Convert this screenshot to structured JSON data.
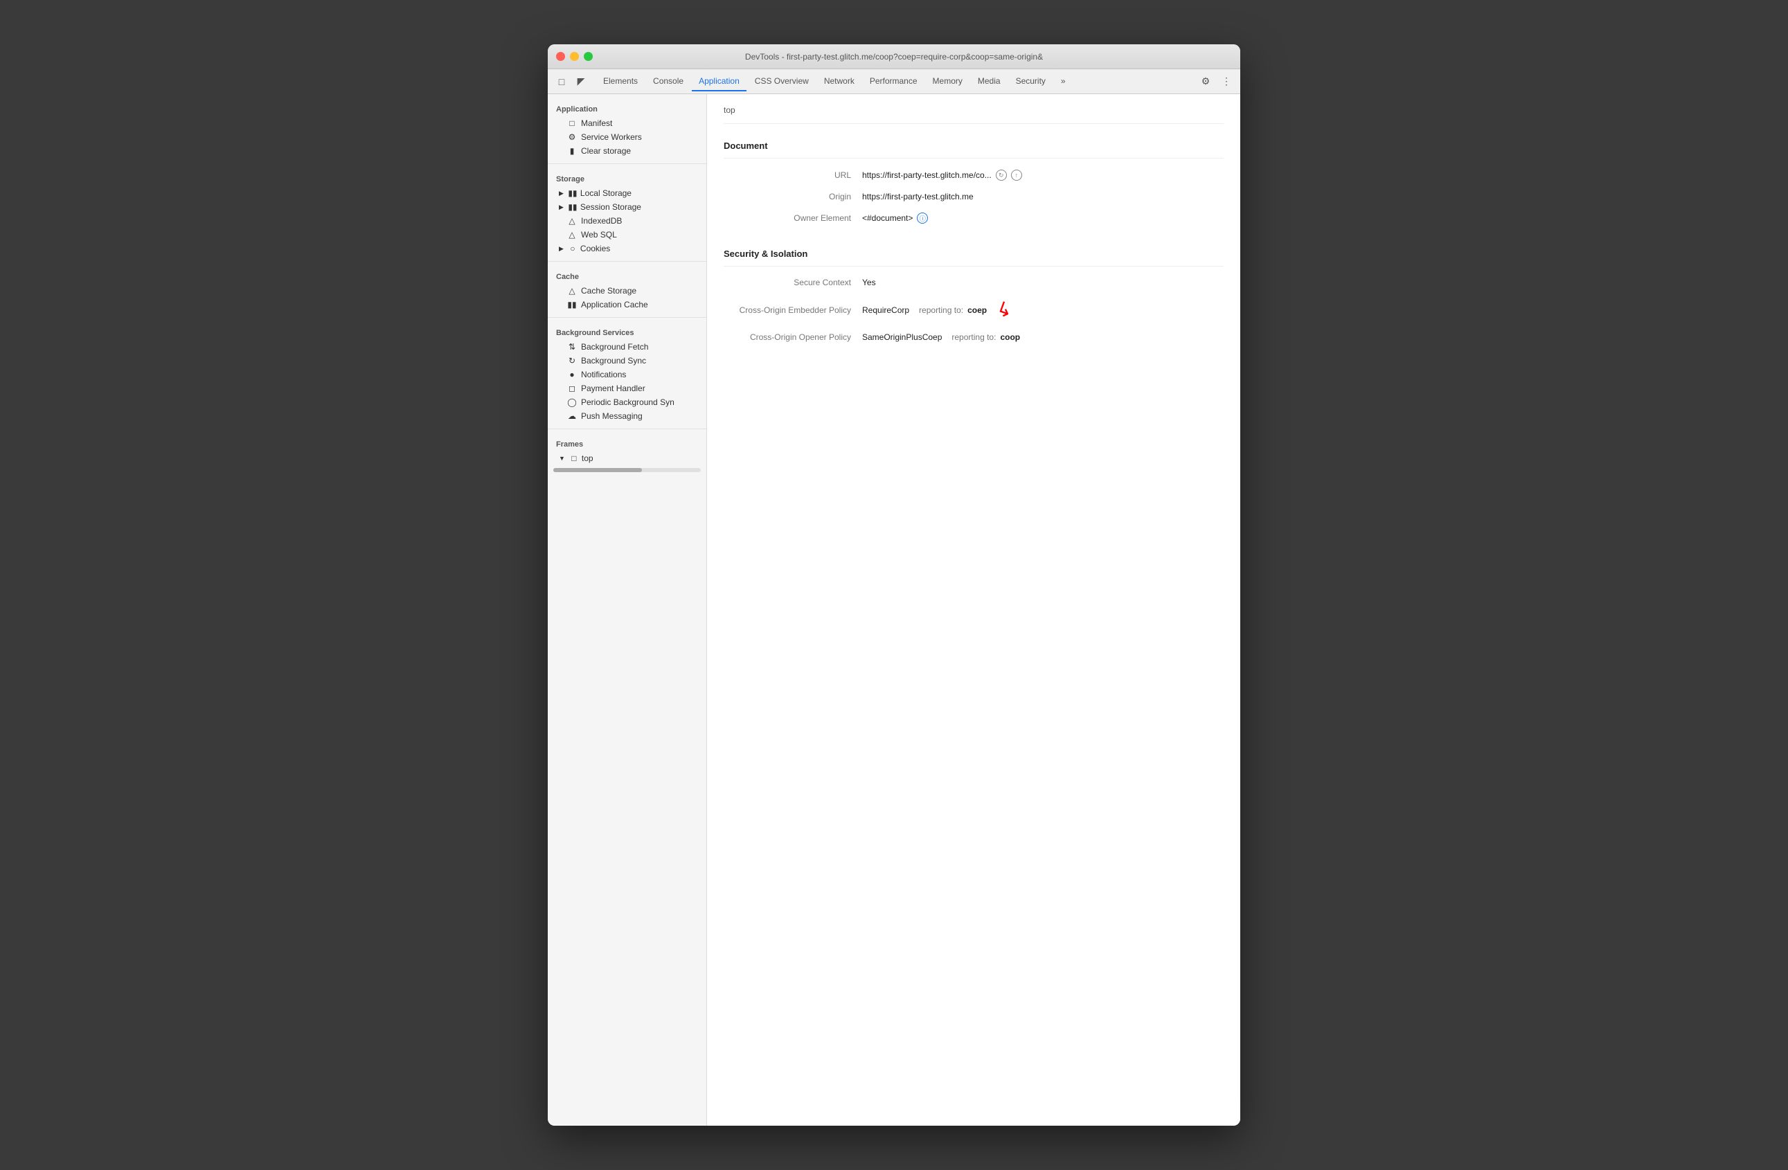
{
  "window": {
    "title": "DevTools - first-party-test.glitch.me/coop?coep=require-corp&coop=same-origin&"
  },
  "toolbar": {
    "tabs": [
      {
        "id": "elements",
        "label": "Elements",
        "active": false
      },
      {
        "id": "console",
        "label": "Console",
        "active": false
      },
      {
        "id": "application",
        "label": "Application",
        "active": true
      },
      {
        "id": "css-overview",
        "label": "CSS Overview",
        "active": false
      },
      {
        "id": "network",
        "label": "Network",
        "active": false
      },
      {
        "id": "performance",
        "label": "Performance",
        "active": false
      },
      {
        "id": "memory",
        "label": "Memory",
        "active": false
      },
      {
        "id": "media",
        "label": "Media",
        "active": false
      },
      {
        "id": "security",
        "label": "Security",
        "active": false
      }
    ]
  },
  "sidebar": {
    "application_label": "Application",
    "manifest_label": "Manifest",
    "service_workers_label": "Service Workers",
    "clear_storage_label": "Clear storage",
    "storage_label": "Storage",
    "local_storage_label": "Local Storage",
    "session_storage_label": "Session Storage",
    "indexeddb_label": "IndexedDB",
    "web_sql_label": "Web SQL",
    "cookies_label": "Cookies",
    "cache_label": "Cache",
    "cache_storage_label": "Cache Storage",
    "application_cache_label": "Application Cache",
    "background_services_label": "Background Services",
    "background_fetch_label": "Background Fetch",
    "background_sync_label": "Background Sync",
    "notifications_label": "Notifications",
    "payment_handler_label": "Payment Handler",
    "periodic_bg_sync_label": "Periodic Background Syn",
    "push_messaging_label": "Push Messaging",
    "frames_label": "Frames",
    "frames_top_label": "top"
  },
  "content": {
    "top_label": "top",
    "document_section": "Document",
    "url_label": "URL",
    "url_value": "https://first-party-test.glitch.me/co...",
    "origin_label": "Origin",
    "origin_value": "https://first-party-test.glitch.me",
    "owner_element_label": "Owner Element",
    "owner_element_value": "<#document>",
    "security_section": "Security & Isolation",
    "secure_context_label": "Secure Context",
    "secure_context_value": "Yes",
    "coep_label": "Cross-Origin Embedder Policy",
    "coep_value": "RequireCorp",
    "coep_reporting": "reporting to:",
    "coep_endpoint": "coep",
    "coop_label": "Cross-Origin Opener Policy",
    "coop_value": "SameOriginPlusCoep",
    "coop_reporting": "reporting to:",
    "coop_endpoint": "coop"
  }
}
